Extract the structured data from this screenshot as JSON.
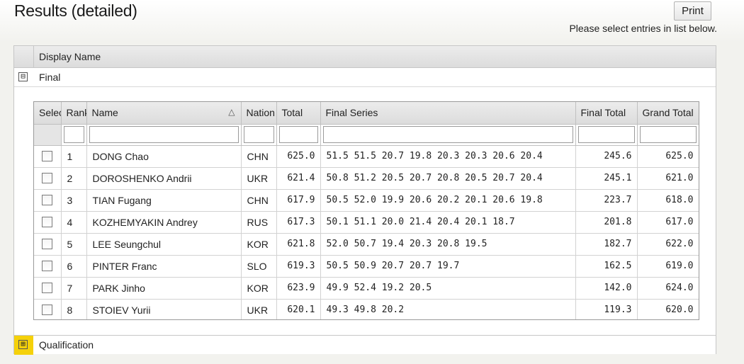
{
  "page": {
    "title": "Results (detailed)",
    "print_label": "Print",
    "hint": "Please select entries in list below."
  },
  "outer_grid": {
    "column_header": "Display Name",
    "groups": [
      {
        "label": "Final",
        "toggle": "⊟"
      },
      {
        "label": "Qualification",
        "toggle": "⊞"
      }
    ]
  },
  "results_table": {
    "columns": [
      "Select",
      "Rank",
      "Name",
      "Nation",
      "Total",
      "Final Series",
      "Final Total",
      "Grand Total"
    ],
    "sort_icon": "triangle-up-icon",
    "rows": [
      {
        "rank": "1",
        "name": "DONG Chao",
        "nation": "CHN",
        "total": "625.0",
        "series": "51.5 51.5 20.7 19.8 20.3 20.3 20.6 20.4",
        "final_total": "245.6",
        "grand_total": "625.0"
      },
      {
        "rank": "2",
        "name": "DOROSHENKO Andrii",
        "nation": "UKR",
        "total": "621.4",
        "series": "50.8 51.2 20.5 20.7 20.8 20.5 20.7 20.4",
        "final_total": "245.1",
        "grand_total": "621.0"
      },
      {
        "rank": "3",
        "name": "TIAN Fugang",
        "nation": "CHN",
        "total": "617.9",
        "series": "50.5 52.0 19.9 20.6 20.2 20.1 20.6 19.8",
        "final_total": "223.7",
        "grand_total": "618.0"
      },
      {
        "rank": "4",
        "name": "KOZHEMYAKIN Andrey",
        "nation": "RUS",
        "total": "617.3",
        "series": "50.1 51.1 20.0 21.4 20.4 20.1 18.7",
        "final_total": "201.8",
        "grand_total": "617.0"
      },
      {
        "rank": "5",
        "name": "LEE Seungchul",
        "nation": "KOR",
        "total": "621.8",
        "series": "52.0 50.7 19.4 20.3 20.8 19.5",
        "final_total": "182.7",
        "grand_total": "622.0"
      },
      {
        "rank": "6",
        "name": "PINTER Franc",
        "nation": "SLO",
        "total": "619.3",
        "series": "50.5 50.9 20.7 20.7 19.7",
        "final_total": "162.5",
        "grand_total": "619.0"
      },
      {
        "rank": "7",
        "name": "PARK Jinho",
        "nation": "KOR",
        "total": "623.9",
        "series": "49.9 52.4 19.2 20.5",
        "final_total": "142.0",
        "grand_total": "624.0"
      },
      {
        "rank": "8",
        "name": "STOIEV Yurii",
        "nation": "UKR",
        "total": "620.1",
        "series": "49.3 49.8 20.2",
        "final_total": "119.3",
        "grand_total": "620.0"
      }
    ]
  }
}
